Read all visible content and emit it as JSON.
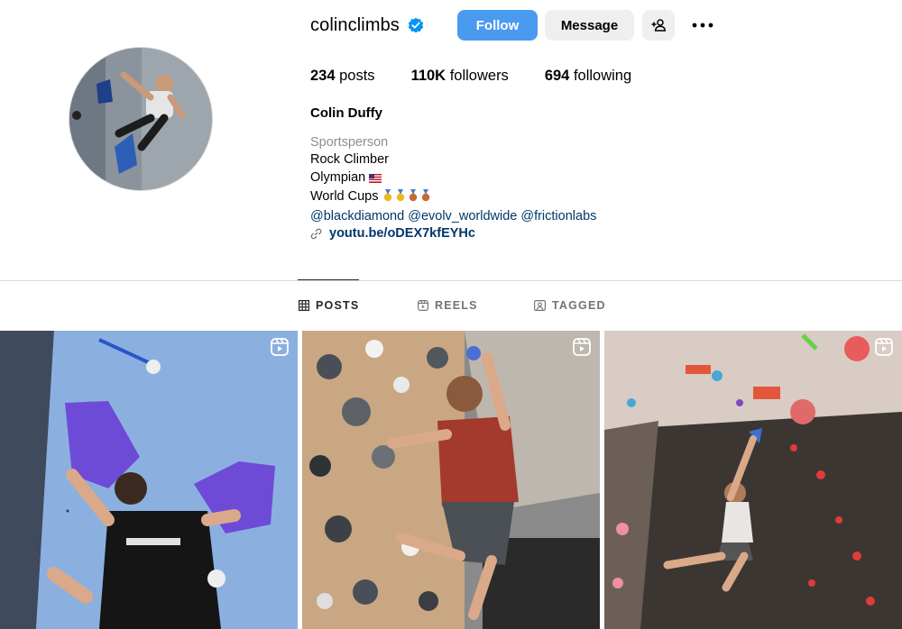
{
  "profile": {
    "username": "colinclimbs",
    "verified_icon": "verified-badge-icon",
    "full_name": "Colin Duffy",
    "category": "Sportsperson",
    "bio_lines": [
      "Rock Climber",
      "Olympian",
      "World Cups"
    ],
    "mentions": "@blackdiamond @evolv_worldwide @frictionlabs",
    "link": "youtu.be/oDEX7kfEYHc"
  },
  "actions": {
    "follow": "Follow",
    "message": "Message"
  },
  "stats": {
    "posts": "234",
    "posts_label": "posts",
    "followers": "110K",
    "followers_label": "followers",
    "following": "694",
    "following_label": "following"
  },
  "tabs": [
    {
      "label": "POSTS",
      "icon": "grid-icon",
      "active": true
    },
    {
      "label": "REELS",
      "icon": "reels-icon",
      "active": false
    },
    {
      "label": "TAGGED",
      "icon": "tagged-icon",
      "active": false
    }
  ],
  "posts": [
    {
      "type": "reel",
      "icon": "reel-badge-icon"
    },
    {
      "type": "reel",
      "icon": "reel-badge-icon"
    },
    {
      "type": "reel",
      "icon": "reel-badge-icon"
    }
  ],
  "colors": {
    "follow_button": "#4a9af0",
    "secondary_button": "#efefef",
    "link": "#00376b",
    "muted": "#8e8e8e",
    "verified": "#0095f6"
  }
}
